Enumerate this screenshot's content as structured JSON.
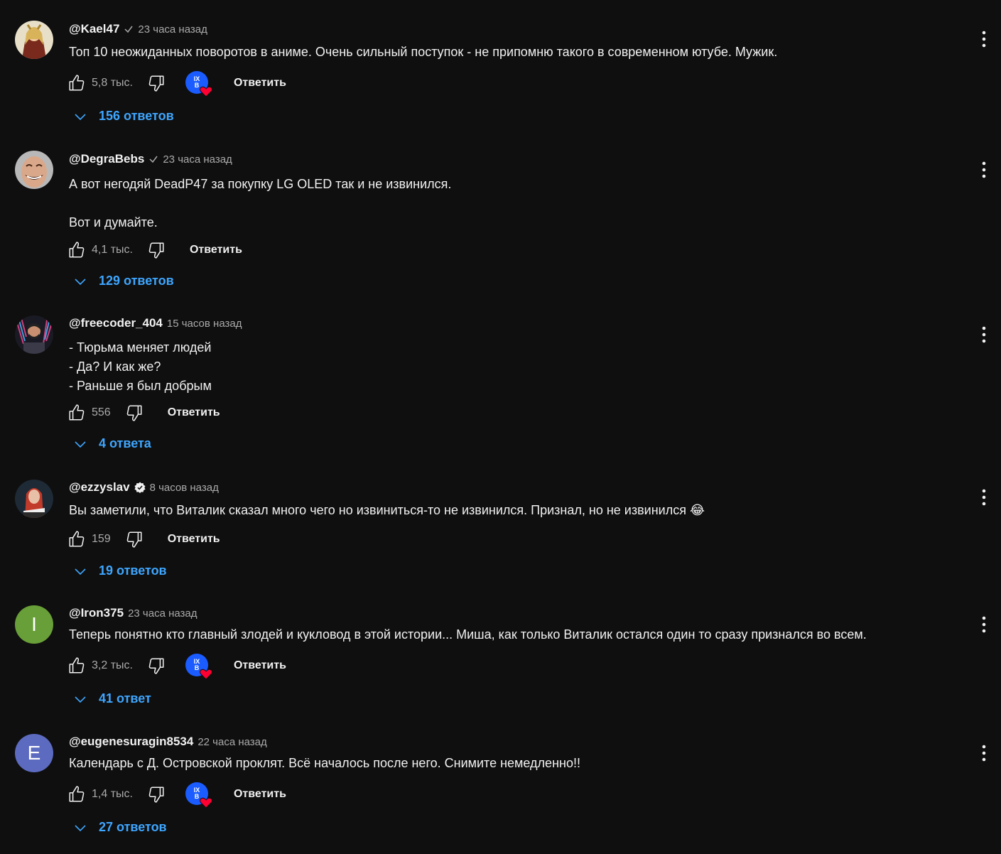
{
  "comments": [
    {
      "author": "@Kael47",
      "time": "23 часа назад",
      "lines": [
        "Топ 10 неожиданных поворотов в аниме. Очень сильный поступок - не припомню такого в современном ютубе. Мужик."
      ],
      "likes": "5,8 тыс.",
      "reply_label": "Ответить",
      "replies": "156 ответов",
      "creator_heart": true,
      "creator_initials": "IX B"
    },
    {
      "author": "@DegraBebs",
      "time": "23 часа назад",
      "lines": [
        "А вот негодяй DeadP47 за покупку LG OLED так и не извинился.",
        "",
        "Вот и думайте."
      ],
      "likes": "4,1 тыс.",
      "reply_label": "Ответить",
      "replies": "129 ответов",
      "creator_heart": false
    },
    {
      "author": "@freecoder_404",
      "time": "15 часов назад",
      "lines": [
        "- Тюрьма меняет людей",
        "- Да? И как же?",
        "- Раньше я был добрым"
      ],
      "likes": "556",
      "reply_label": "Ответить",
      "replies": "4 ответа",
      "creator_heart": false
    },
    {
      "author": "@ezzyslav",
      "time": "8 часов назад",
      "lines": [
        "Вы заметили, что Виталик сказал много чего но извиниться-то не извинился. Признал, но не извинился 😂"
      ],
      "likes": "159",
      "reply_label": "Ответить",
      "replies": "19 ответов",
      "creator_heart": false
    },
    {
      "author": "@Iron375",
      "time": "23 часа назад",
      "lines": [
        "Теперь понятно кто главный злодей и кукловод в этой истории... Миша, как только Виталик остался один то сразу признался во всем."
      ],
      "likes": "3,2 тыс.",
      "reply_label": "Ответить",
      "replies": "41 ответ",
      "creator_heart": true,
      "avatar_letter": "I"
    },
    {
      "author": "@eugenesuragin8534",
      "time": "22 часа назад",
      "lines": [
        "Календарь с Д. Островской проклят. Всё началось после него. Снимите немедленно!!"
      ],
      "likes": "1,4 тыс.",
      "reply_label": "Ответить",
      "replies": "27 ответов",
      "creator_heart": true,
      "avatar_letter": "E"
    }
  ],
  "colors": {
    "background": "#0f0f0f",
    "text": "#f1f1f1",
    "secondary": "#aaaaaa",
    "link": "#3ea6ff",
    "avatar_I": "#689f38",
    "avatar_E": "#5c6bc0",
    "creator_avatar": "#1a5cff",
    "heart": "#ff0033"
  },
  "icons": {
    "like": "thumb-up-icon",
    "dislike": "thumb-down-icon",
    "more": "more-vert-icon",
    "expand": "chevron-down-icon",
    "verified": "check-icon",
    "verified_artist": "verified-badge-icon"
  }
}
